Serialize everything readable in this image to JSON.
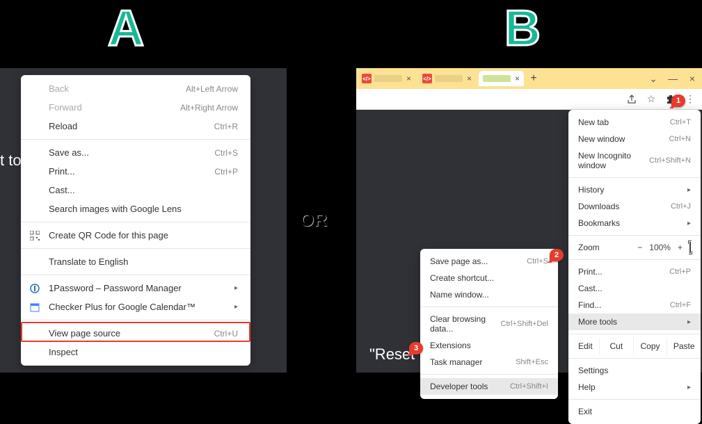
{
  "labels": {
    "A": "A",
    "B": "B",
    "or": "OR"
  },
  "truncated": {
    "a": "t to",
    "b": "\"Reset\" to"
  },
  "menuA": {
    "items": [
      {
        "label": "Back",
        "shortcut": "Alt+Left Arrow",
        "disabled": true
      },
      {
        "label": "Forward",
        "shortcut": "Alt+Right Arrow",
        "disabled": true
      },
      {
        "label": "Reload",
        "shortcut": "Ctrl+R"
      },
      {
        "sep": true
      },
      {
        "label": "Save as...",
        "shortcut": "Ctrl+S"
      },
      {
        "label": "Print...",
        "shortcut": "Ctrl+P"
      },
      {
        "label": "Cast..."
      },
      {
        "label": "Search images with Google Lens"
      },
      {
        "sep": true
      },
      {
        "label": "Create QR Code for this page",
        "icon": "qr"
      },
      {
        "sep": true
      },
      {
        "label": "Translate to English"
      },
      {
        "sep": true
      },
      {
        "label": "1Password – Password Manager",
        "submenu": true,
        "icon": "1p"
      },
      {
        "label": "Checker Plus for Google Calendar™",
        "submenu": true,
        "icon": "cal"
      },
      {
        "sep": true
      },
      {
        "label": "View page source",
        "shortcut": "Ctrl+U"
      },
      {
        "label": "Inspect"
      }
    ]
  },
  "tabs": {
    "close": "×",
    "new": "+"
  },
  "winbtns": {
    "chevron": "⌄",
    "min": "—",
    "close": "×"
  },
  "toolbar": {
    "share": "share",
    "star": "star",
    "ext": "ext",
    "kebab": "kebab"
  },
  "menuB": {
    "newtab": {
      "label": "New tab",
      "shortcut": "Ctrl+T"
    },
    "newwin": {
      "label": "New window",
      "shortcut": "Ctrl+N"
    },
    "incog": {
      "label": "New Incognito window",
      "shortcut": "Ctrl+Shift+N"
    },
    "history": {
      "label": "History"
    },
    "downloads": {
      "label": "Downloads",
      "shortcut": "Ctrl+J"
    },
    "bookmarks": {
      "label": "Bookmarks"
    },
    "zoom": {
      "label": "Zoom",
      "minus": "−",
      "value": "100%",
      "plus": "+"
    },
    "print": {
      "label": "Print...",
      "shortcut": "Ctrl+P"
    },
    "cast": {
      "label": "Cast..."
    },
    "find": {
      "label": "Find...",
      "shortcut": "Ctrl+F"
    },
    "moretools": {
      "label": "More tools"
    },
    "edit": {
      "label": "Edit",
      "cut": "Cut",
      "copy": "Copy",
      "paste": "Paste"
    },
    "settings": {
      "label": "Settings"
    },
    "help": {
      "label": "Help"
    },
    "exit": {
      "label": "Exit"
    }
  },
  "submenuB": {
    "savepage": {
      "label": "Save page as...",
      "shortcut": "Ctrl+S"
    },
    "shortcut": {
      "label": "Create shortcut..."
    },
    "namewin": {
      "label": "Name window..."
    },
    "clear": {
      "label": "Clear browsing data...",
      "shortcut": "Ctrl+Shift+Del"
    },
    "ext": {
      "label": "Extensions"
    },
    "taskmgr": {
      "label": "Task manager",
      "shortcut": "Shift+Esc"
    },
    "devtools": {
      "label": "Developer tools",
      "shortcut": "Ctrl+Shift+I"
    }
  },
  "badges": {
    "b1": "1",
    "b2": "2",
    "b3": "3"
  }
}
